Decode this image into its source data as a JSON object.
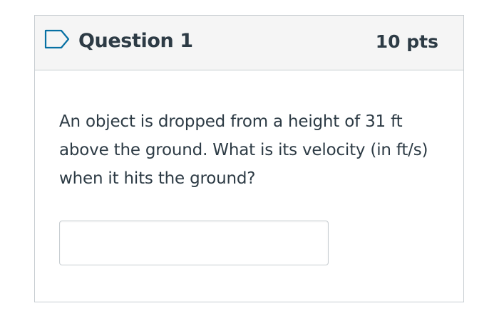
{
  "question": {
    "title": "Question 1",
    "points": "10 pts",
    "flag_icon": "flag-outline-icon",
    "text": "An object is dropped from a height of 31 ft above the ground. What is its velocity (in ft/s) when it hits the ground?",
    "answer": {
      "value": "",
      "placeholder": ""
    }
  },
  "colors": {
    "header_background": "#f5f5f5",
    "border": "#c7cdd1",
    "text": "#2d3b45",
    "flag": "#0770a3"
  }
}
